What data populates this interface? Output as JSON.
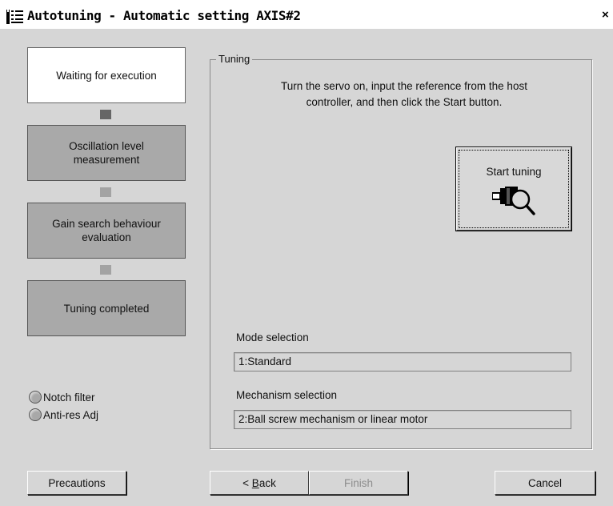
{
  "window": {
    "title": "Autotuning - Automatic setting AXIS#2",
    "close_glyph": "×",
    "app_icon": "autotuning-app-icon"
  },
  "steps": [
    {
      "label": "Waiting for execution",
      "state": "active"
    },
    {
      "label": "Oscillation level measurement",
      "state": "pending"
    },
    {
      "label": "Gain search behaviour evaluation",
      "state": "pending"
    },
    {
      "label": "Tuning completed",
      "state": "pending"
    }
  ],
  "indicators": [
    {
      "label": "Notch filter",
      "state": "off"
    },
    {
      "label": "Anti-res Adj",
      "state": "off"
    }
  ],
  "tuning": {
    "group_label": "Tuning",
    "instructions_line1": "Turn the servo on, input the reference from the host",
    "instructions_line2": "controller, and then click the Start button.",
    "start_button_label": "Start tuning",
    "start_button_icon": "motor-magnifier-icon",
    "mode_label": "Mode selection",
    "mode_value": "1:Standard",
    "mechanism_label": "Mechanism selection",
    "mechanism_value": "2:Ball screw mechanism or linear motor"
  },
  "footer": {
    "precautions_label": "Precautions",
    "back_prefix": "< ",
    "back_underlined": "B",
    "back_rest": "ack",
    "finish_label": "Finish",
    "cancel_label": "Cancel"
  },
  "colors": {
    "window_bg": "#d6d6d6",
    "step_active_bg": "#ffffff",
    "step_pending_bg": "#a9a9a9",
    "connector_active": "#666666",
    "connector_pending": "#a3a3a3",
    "disabled_text": "#8c8c8c"
  }
}
